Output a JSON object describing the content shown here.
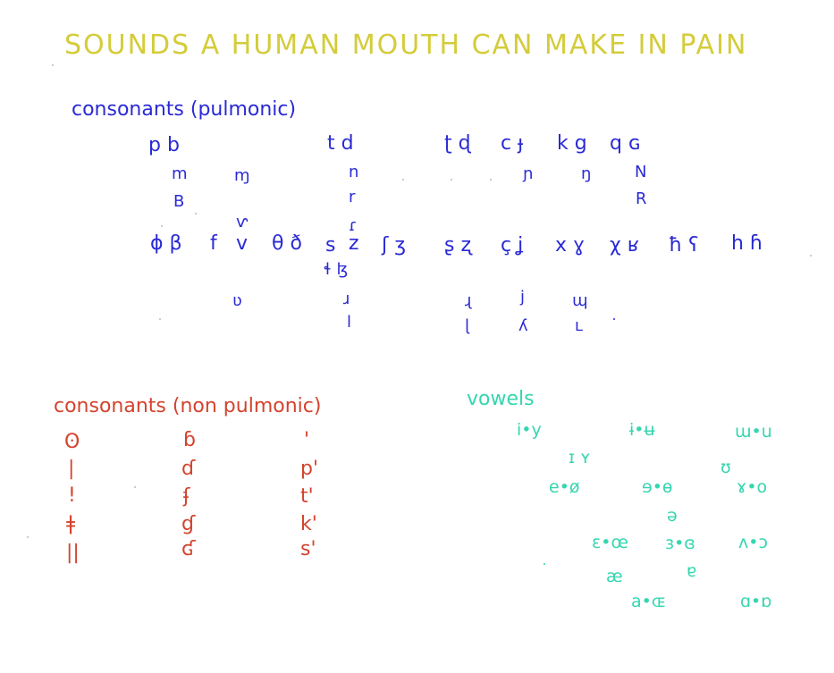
{
  "title": "SOUNDS A HUMAN MOUTH CAN MAKE IN PAIN",
  "pulmonic": {
    "heading": "consonants (pulmonic)",
    "row_plosive": [
      "p b",
      "t d",
      "ʈ ɖ",
      "c ɟ",
      "k g",
      "q ɢ"
    ],
    "row_nasal": [
      "m",
      "ɱ",
      "n",
      "ɲ",
      "ŋ",
      "N"
    ],
    "row_trill": [
      "B",
      "r",
      "R"
    ],
    "row_tap": [
      "ⱱ",
      "ɾ"
    ],
    "row_fricative": [
      "ɸ β",
      "f",
      "v",
      "θ ð",
      "s",
      "z",
      "ʃ ʒ",
      "ʂ ʐ",
      "ç ʝ",
      "x ɣ",
      "χ ʁ",
      "ħ ʕ",
      "h ɦ"
    ],
    "row_lateral_fric": [
      "ɬ ɮ"
    ],
    "row_approximant": [
      "ʋ",
      "ɹ",
      "ɻ",
      "j",
      "ɰ"
    ],
    "row_lateral_approx": [
      "l",
      "ɭ",
      "ʎ",
      "ʟ"
    ]
  },
  "nonpulmonic": {
    "heading": "consonants (non pulmonic)",
    "clicks": [
      "ʘ",
      "|",
      "!",
      "ǂ",
      "||"
    ],
    "implosives": [
      "ɓ",
      "ɗ",
      "ʄ",
      "ɠ",
      "ʛ"
    ],
    "ejectives": [
      "'",
      "p'",
      "t'",
      "k'",
      "s'"
    ]
  },
  "vowels": {
    "heading": "vowels",
    "items": [
      "i•y",
      "ɨ•ʉ",
      "ɯ•u",
      "ɪ ʏ",
      "ʊ",
      "e•ø",
      "ɘ•ɵ",
      "ɤ•o",
      "ə",
      "ɛ•œ",
      "ɜ•ɞ",
      "ʌ•ɔ",
      "æ",
      "ɐ",
      "a•ɶ",
      "ɑ•ɒ"
    ]
  }
}
